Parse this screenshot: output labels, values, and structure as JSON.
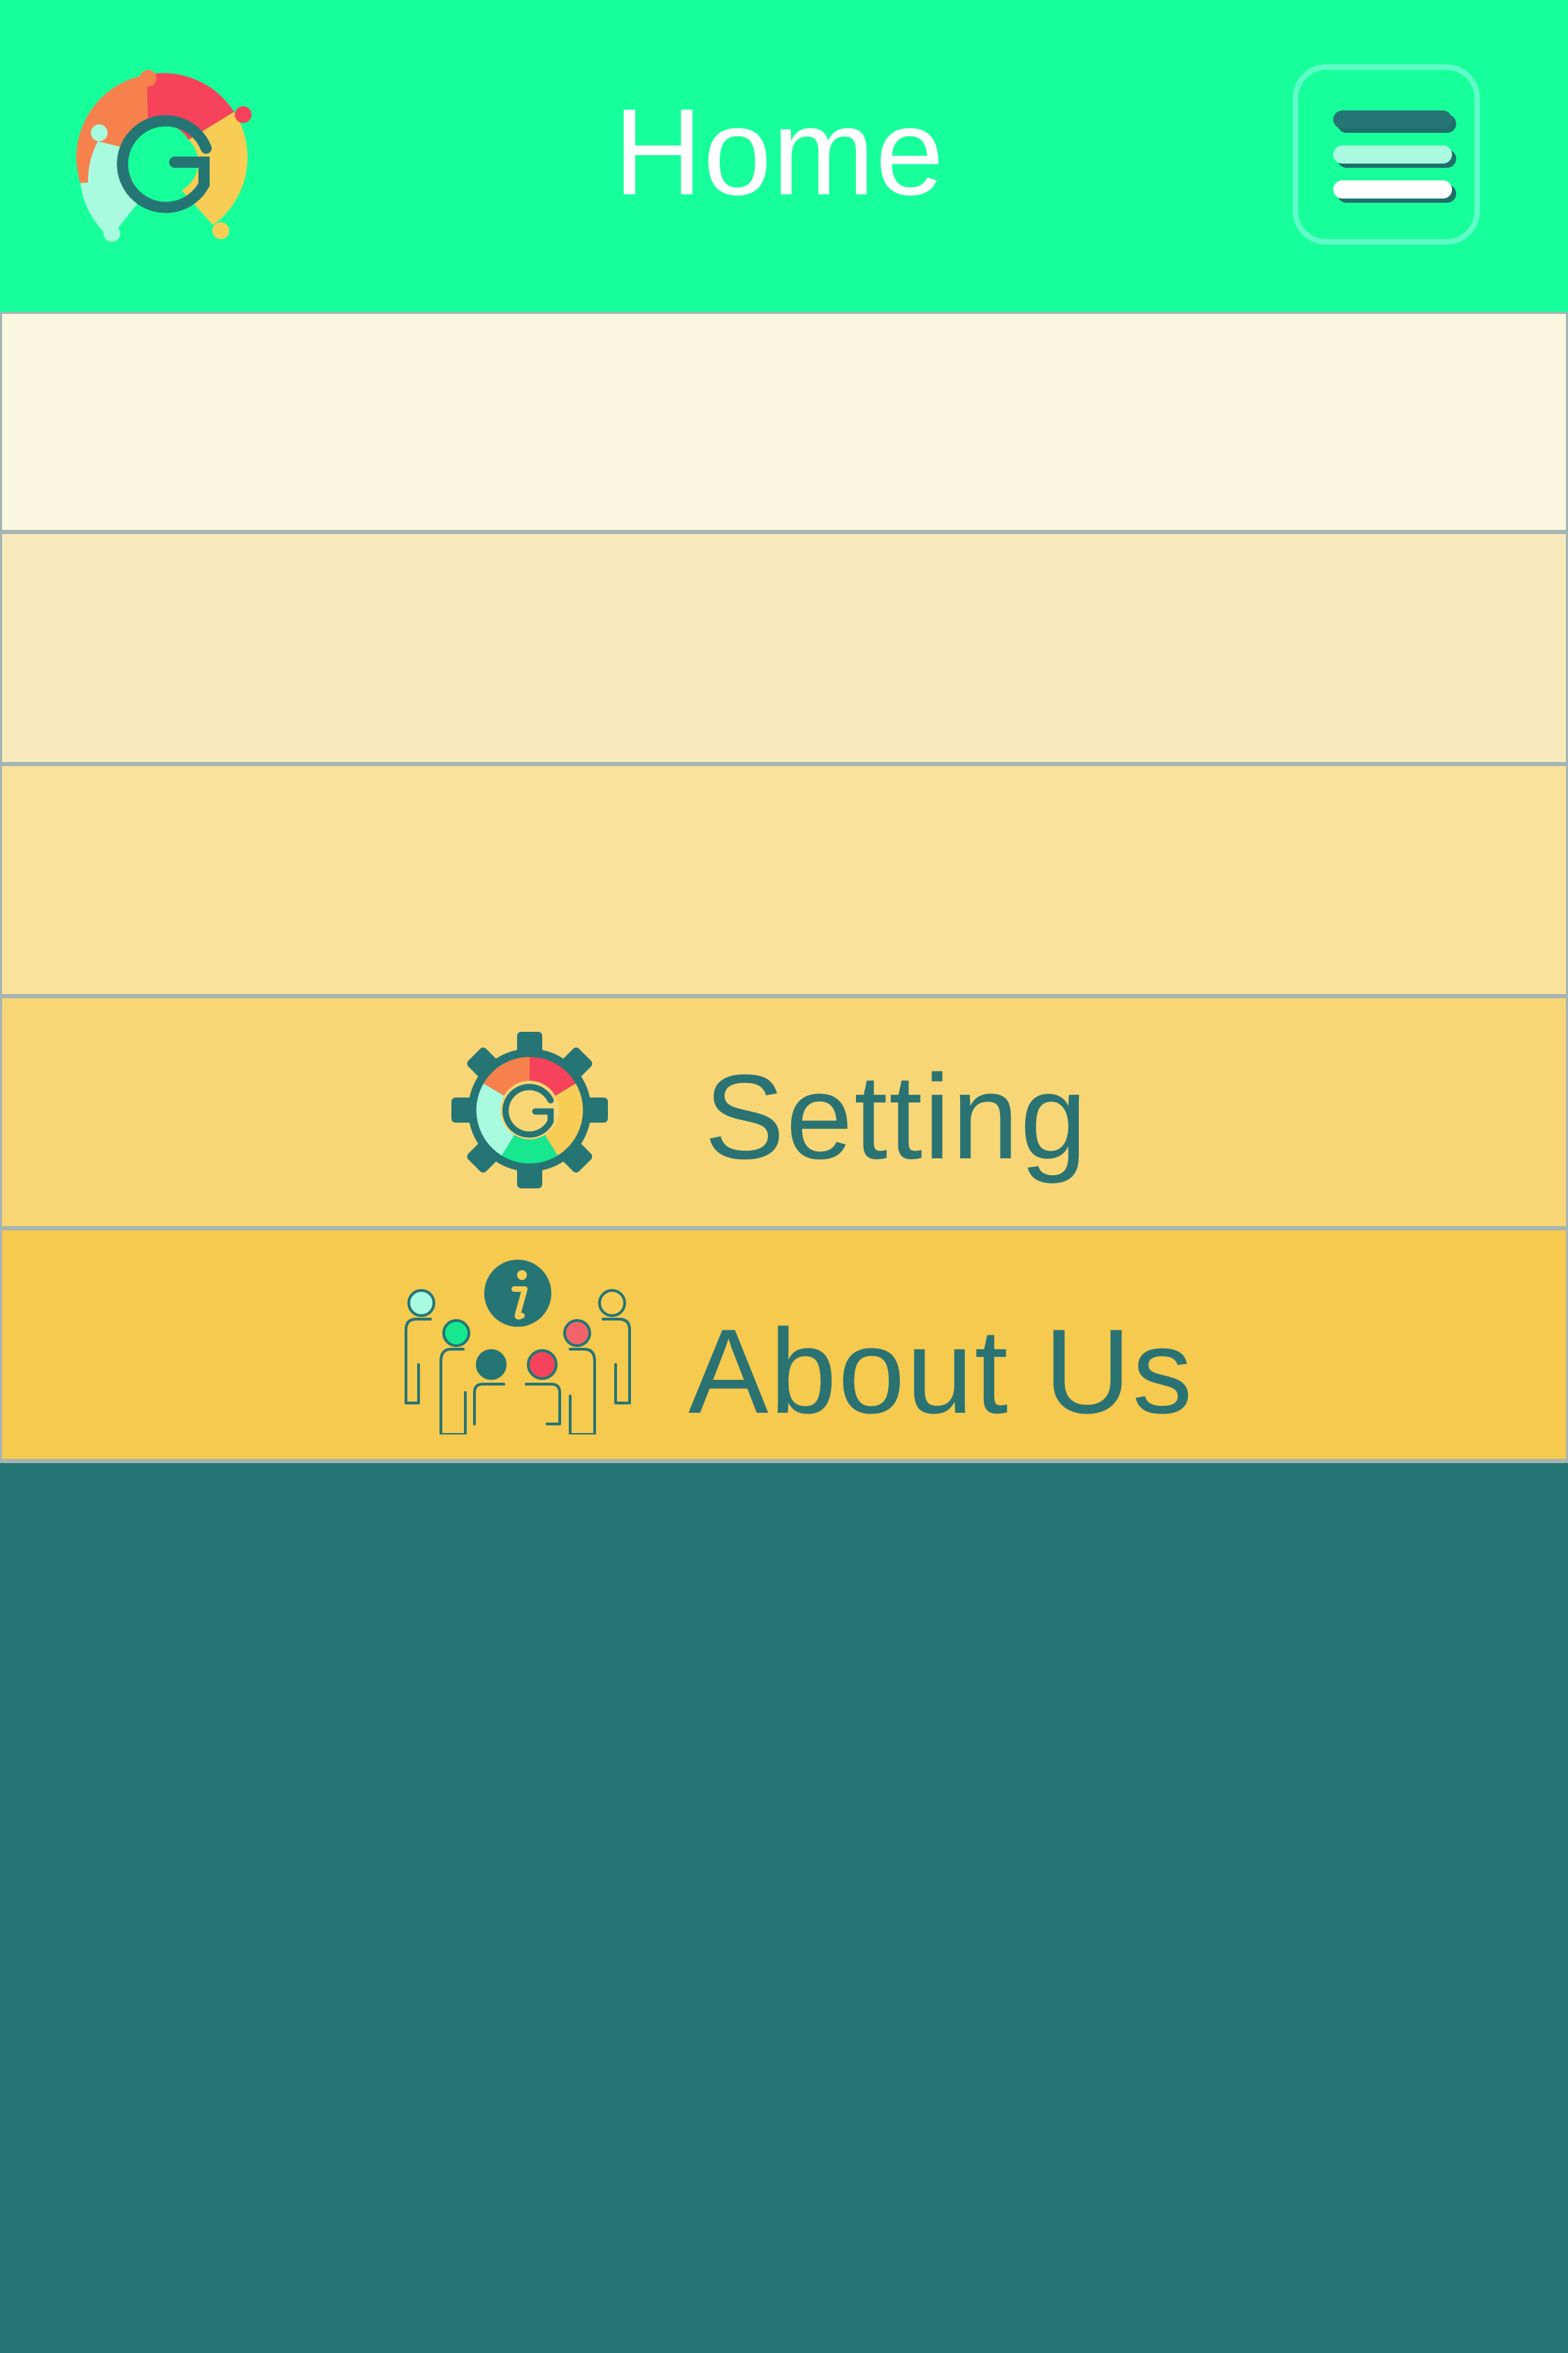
{
  "header": {
    "title": "Home",
    "logo_icon": "puzzle-g-logo-icon",
    "menu_icon": "hamburger-menu-icon"
  },
  "menu": {
    "items": [
      {
        "label": "",
        "background": "#faf7e0"
      },
      {
        "label": "",
        "background": "#f9eabd"
      },
      {
        "label": "",
        "background": "#f9e39b"
      },
      {
        "label": "Setting",
        "icon": "gear-icon",
        "background": "#f8d676"
      },
      {
        "label": "About Us",
        "icon": "team-info-icon",
        "background": "#f6c94f"
      }
    ]
  },
  "colors": {
    "header": "#17ff9a",
    "background": "#257574",
    "text_dark": "#2a7372",
    "divider": "#a4b5b3"
  }
}
